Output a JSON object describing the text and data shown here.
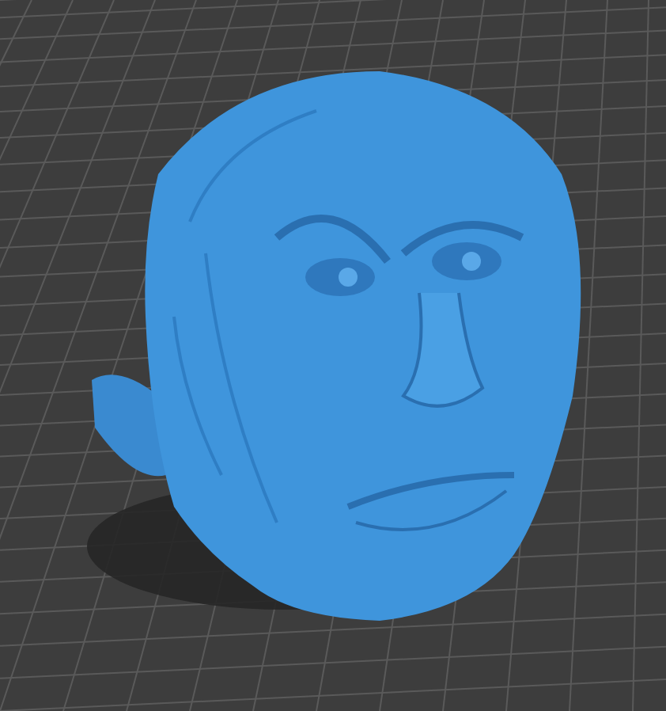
{
  "viewport": {
    "grid": true,
    "shadow": true
  }
}
